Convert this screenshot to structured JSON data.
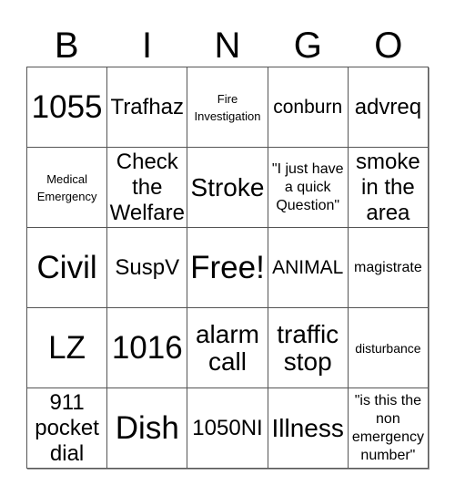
{
  "header": {
    "letters": [
      "B",
      "I",
      "N",
      "G",
      "O"
    ]
  },
  "board": {
    "rows": [
      [
        {
          "text": "1055",
          "size": "s-xl"
        },
        {
          "text": "Trafhaz",
          "size": "s-ml"
        },
        {
          "text": "Fire Investigation",
          "size": "s-xxs"
        },
        {
          "text": "conburn",
          "size": "s-m"
        },
        {
          "text": "advreq",
          "size": "s-ml"
        }
      ],
      [
        {
          "text": "Medical Emergency",
          "size": "s-xxs"
        },
        {
          "text": "Check the Welfare",
          "size": "s-ml"
        },
        {
          "text": "Stroke",
          "size": "s-l"
        },
        {
          "text": "\"I just have a quick Question\"",
          "size": "s-s"
        },
        {
          "text": "smoke in the area",
          "size": "s-ml"
        }
      ],
      [
        {
          "text": "Civil",
          "size": "s-xl"
        },
        {
          "text": "SuspV",
          "size": "s-ml"
        },
        {
          "text": "Free!",
          "size": "s-xl"
        },
        {
          "text": "ANIMAL",
          "size": "s-m"
        },
        {
          "text": "magistrate",
          "size": "s-s"
        }
      ],
      [
        {
          "text": "LZ",
          "size": "s-xl"
        },
        {
          "text": "1016",
          "size": "s-xl"
        },
        {
          "text": "alarm call",
          "size": "s-l"
        },
        {
          "text": "traffic stop",
          "size": "s-l"
        },
        {
          "text": "disturbance",
          "size": "s-tiny"
        }
      ],
      [
        {
          "text": "911 pocket dial",
          "size": "s-ml"
        },
        {
          "text": "Dish",
          "size": "s-xl"
        },
        {
          "text": "1050NI",
          "size": "s-ml"
        },
        {
          "text": "Illness",
          "size": "s-l"
        },
        {
          "text": "\"is this the non emergency number\"",
          "size": "s-s"
        }
      ]
    ]
  }
}
